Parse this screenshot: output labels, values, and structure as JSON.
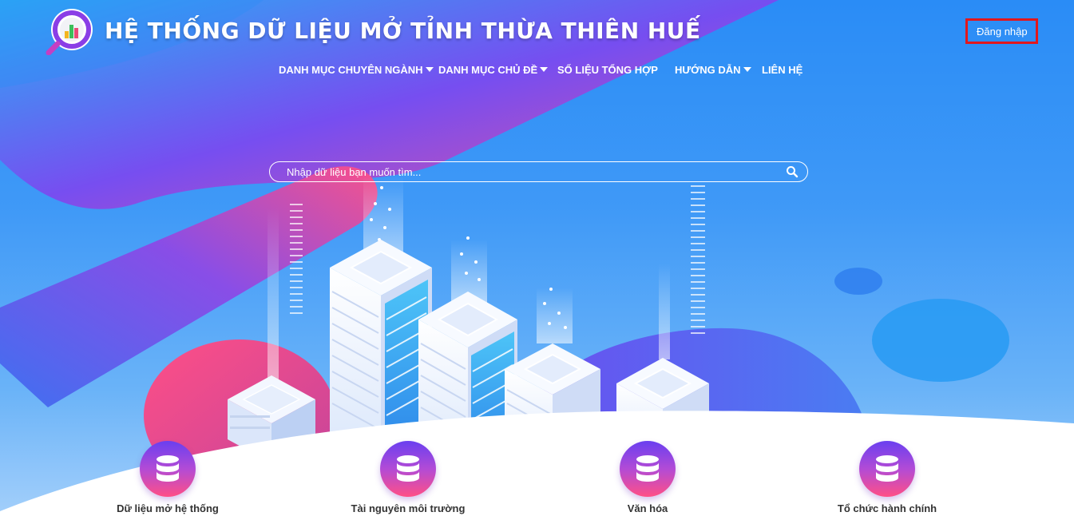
{
  "header": {
    "title": "HỆ THỐNG DỮ LIỆU MỞ TỈNH THỪA THIÊN HUẾ",
    "login_label": "Đăng nhập"
  },
  "nav": {
    "items": [
      {
        "label": "DANH MỤC CHUYÊN NGÀNH",
        "has_dropdown": true
      },
      {
        "label": "DANH MỤC CHỦ ĐỀ",
        "has_dropdown": true
      },
      {
        "label": "SỐ LIỆU TỔNG HỢP",
        "has_dropdown": false
      },
      {
        "label": "HƯỚNG DẪN",
        "has_dropdown": true
      },
      {
        "label": "LIÊN HỆ",
        "has_dropdown": false
      }
    ]
  },
  "search": {
    "placeholder": "Nhập dữ liệu bạn muốn tìm..."
  },
  "categories": [
    {
      "label": "Dữ liệu mở hệ thống",
      "icon": "database-icon"
    },
    {
      "label": "Tài nguyên môi trường",
      "icon": "database-icon"
    },
    {
      "label": "Văn hóa",
      "icon": "database-icon"
    },
    {
      "label": "Tổ chức hành chính",
      "icon": "database-icon"
    }
  ],
  "colors": {
    "background": "#2a8cf6",
    "accent_pink": "#ff4f86",
    "accent_purple": "#7a4af0",
    "login_border": "#e2171c"
  }
}
